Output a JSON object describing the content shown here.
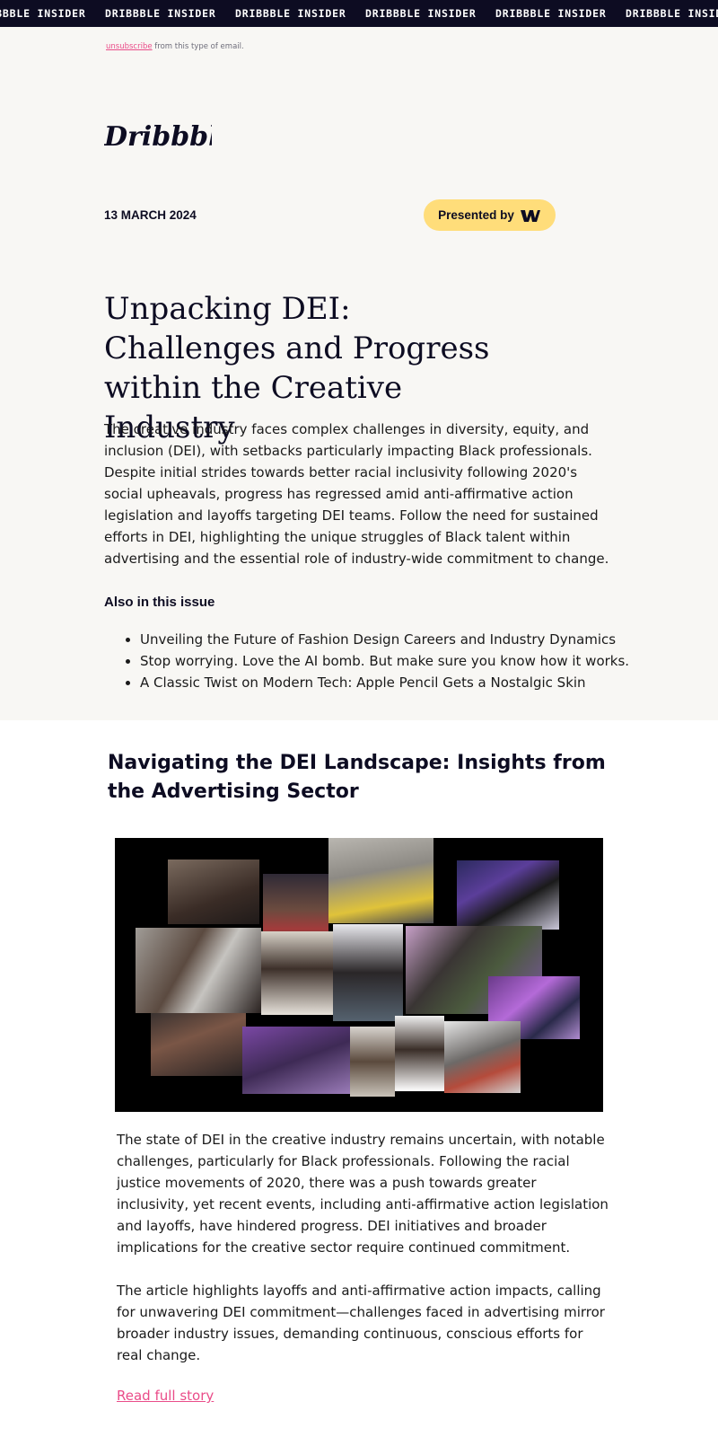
{
  "ticker": {
    "label": "DRIBBBLE INSIDER",
    "repeat": 6
  },
  "header": {
    "unsubscribe_link": "unsubscribe",
    "unsubscribe_rest": " from this type of email.",
    "logo_text": "Dribbble",
    "date": "13 MARCH 2024",
    "presented_by": "Presented by"
  },
  "hero": {
    "headline": "Unpacking DEI: Challenges and Progress within the Creative Industry",
    "intro": "The creative industry faces complex challenges in diversity, equity, and inclusion (DEI), with setbacks particularly impacting Black professionals. Despite initial strides towards better racial inclusivity following 2020's social upheavals, progress has regressed amid anti-affirmative action legislation and layoffs targeting DEI teams. Follow the need for sustained efforts in DEI, highlighting the unique struggles of Black talent within advertising and the essential role of industry-wide commitment to change."
  },
  "also": {
    "title": "Also in this issue",
    "items": [
      "Unveiling the Future of Fashion Design Careers and Industry Dynamics",
      "Stop worrying. Love the AI bomb. But make sure you know how it works.",
      "A Classic Twist on Modern Tech: Apple Pencil Gets a Nostalgic Skin"
    ]
  },
  "article": {
    "title": "Navigating the DEI Landscape: Insights from the Advertising Sector",
    "paragraph1": "The state of DEI in the creative industry remains uncertain, with notable challenges, particularly for Black professionals. Following the racial justice movements of 2020, there was a push towards greater inclusivity, yet recent events, including anti-affirmative action legislation and layoffs, have hindered progress. DEI initiatives and broader implications for the creative sector require continued commitment.",
    "paragraph2": "The article highlights layoffs and anti-affirmative action impacts, calling for unwavering DEI commitment—challenges faced in advertising mirror broader industry issues, demanding continuous, conscious efforts for real change.",
    "read_more": "Read full story"
  },
  "colors": {
    "ink": "#0d0c22",
    "ticker_bg": "#0d0c22",
    "top_bg": "#f8f7f4",
    "badge_bg": "#ffdd7a",
    "link_pink": "#ea4c89",
    "collage_bg": "#000000"
  },
  "icons": {
    "sponsor_logo": "webflow-icon"
  }
}
